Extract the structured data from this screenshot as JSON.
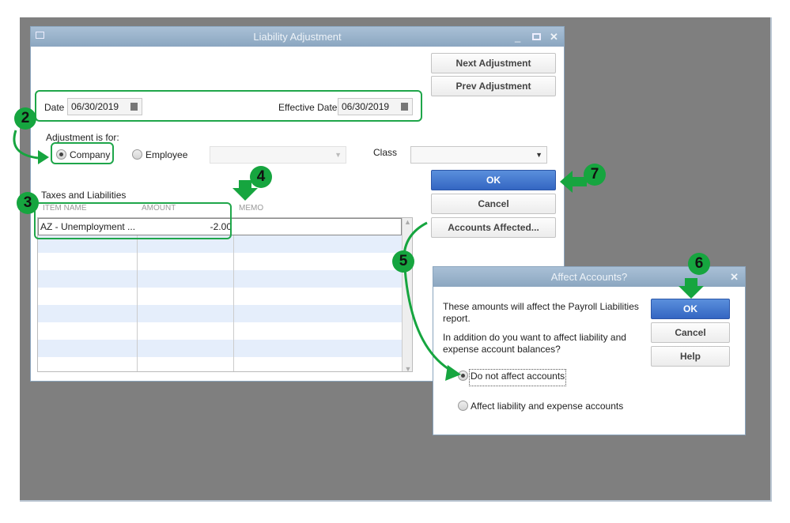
{
  "main_window": {
    "title": "Liability Adjustment",
    "next_button": "Next Adjustment",
    "prev_button": "Prev Adjustment",
    "date_label": "Date",
    "date_value": "06/30/2019",
    "effective_date_label": "Effective Date",
    "effective_date_value": "06/30/2019",
    "adjustment_for_label": "Adjustment is for:",
    "company_label": "Company",
    "employee_label": "Employee",
    "class_label": "Class",
    "ok_button": "OK",
    "cancel_button": "Cancel",
    "accounts_affected_button": "Accounts Affected...",
    "selected_option": "Company",
    "table": {
      "title": "Taxes and Liabilities",
      "columns": [
        "ITEM NAME",
        "AMOUNT",
        "MEMO"
      ],
      "rows": [
        {
          "item": "AZ - Unemployment ...",
          "amount": "-2.00",
          "memo": ""
        }
      ]
    }
  },
  "dialog": {
    "title": "Affect Accounts?",
    "message1": "These amounts will affect the Payroll Liabilities report.",
    "message2": "In addition do you want to affect liability and expense account balances?",
    "option1": "Do not affect accounts",
    "option2": "Affect liability and expense accounts",
    "selected_option": "Do not affect accounts",
    "ok_button": "OK",
    "cancel_button": "Cancel",
    "help_button": "Help"
  },
  "annotations": {
    "step2": "2",
    "step3": "3",
    "step4": "4",
    "step5": "5",
    "step6": "6",
    "step7": "7",
    "color": "#16a53f"
  }
}
